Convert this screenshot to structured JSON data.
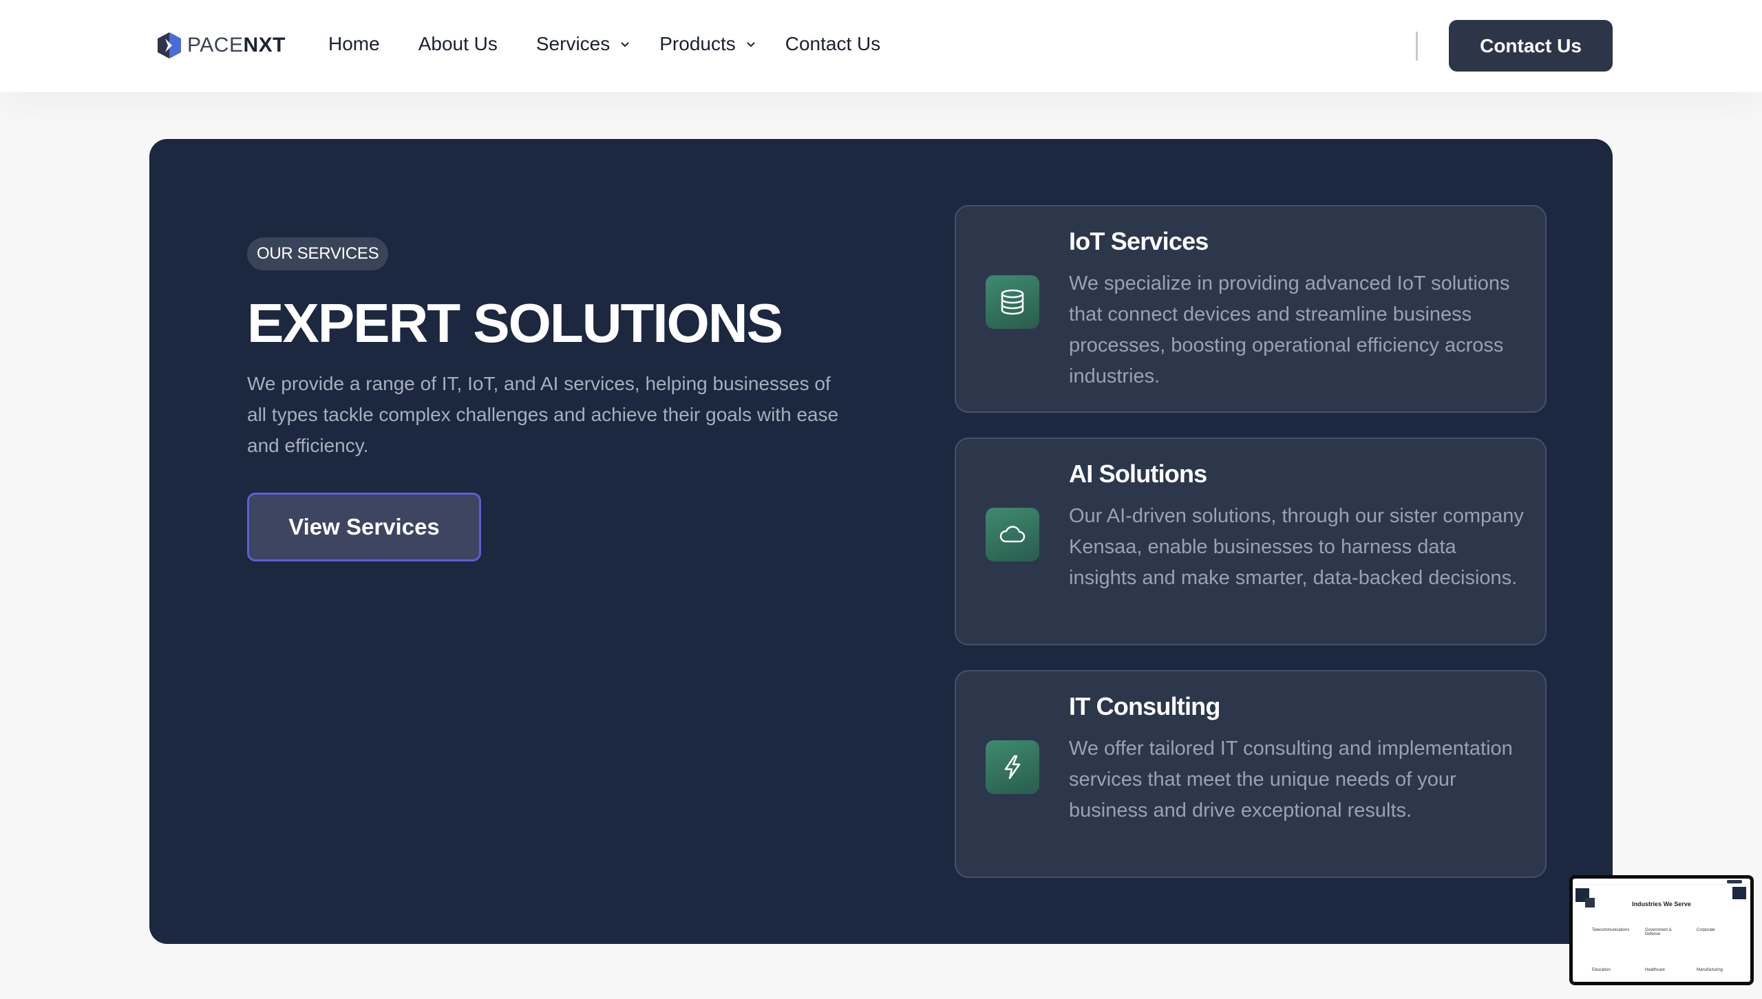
{
  "brand": {
    "logo_light": "PACE",
    "logo_bold": "NXT"
  },
  "nav": {
    "home": "Home",
    "about": "About Us",
    "services": "Services",
    "products": "Products",
    "contact": "Contact Us"
  },
  "header": {
    "cta_label": "Contact Us"
  },
  "hero": {
    "eyebrow": "OUR SERVICES",
    "headline": "EXPERT SOLUTIONS",
    "lead": "We provide a range of IT, IoT, and AI services, helping businesses of all types tackle complex challenges and achieve their goals with ease and efficiency.",
    "cta_label": "View Services"
  },
  "cards": [
    {
      "icon": "database-icon",
      "title": "IoT Services",
      "desc": "We specialize in providing advanced IoT solutions that connect devices and streamline business processes, boosting operational efficiency across industries."
    },
    {
      "icon": "cloud-icon",
      "title": "AI Solutions",
      "desc": "Our AI-driven solutions, through our sister company Kensaa, enable businesses to harness data insights and make smarter, data-backed decisions."
    },
    {
      "icon": "lightning-icon",
      "title": "IT Consulting",
      "desc": "We offer tailored IT consulting and implementation services that meet the unique needs of your business and drive exceptional results."
    }
  ],
  "preview": {
    "title": "Industries We Serve",
    "items": [
      "Telecommunications",
      "Government & Defense",
      "Corporate",
      "Education",
      "Healthcare",
      "Manufacturing"
    ]
  },
  "colors": {
    "panel": "#1c2740",
    "card": "#2c374c",
    "cta": "#2d3549",
    "icon_green": "#3f8a6f",
    "button_border": "#5a5fd6"
  }
}
